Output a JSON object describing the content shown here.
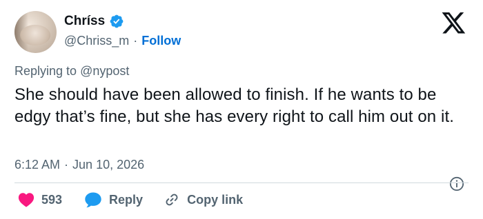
{
  "author": {
    "display_name": "Chríss",
    "handle": "@Chriss_m",
    "separator": "·",
    "follow_label": "Follow"
  },
  "reply_context": {
    "prefix": "Replying to",
    "handle": "@nypost"
  },
  "tweet": {
    "text": "She should have been allowed to finish. If he wants to be edgy that’s fine, but she has every right to call him out on it.",
    "time": "6:12 AM",
    "separator": "·",
    "date": "Jun 10, 2026"
  },
  "actions": {
    "like_count": "593",
    "reply_label": "Reply",
    "copy_label": "Copy link"
  },
  "colors": {
    "accent": "#006fd6",
    "like": "#f91880",
    "muted": "#536471",
    "verified": "#1d9bf0"
  },
  "icons": [
    "verified-badge-icon",
    "x-logo-icon",
    "info-icon",
    "heart-icon",
    "reply-bubble-icon",
    "link-icon"
  ]
}
